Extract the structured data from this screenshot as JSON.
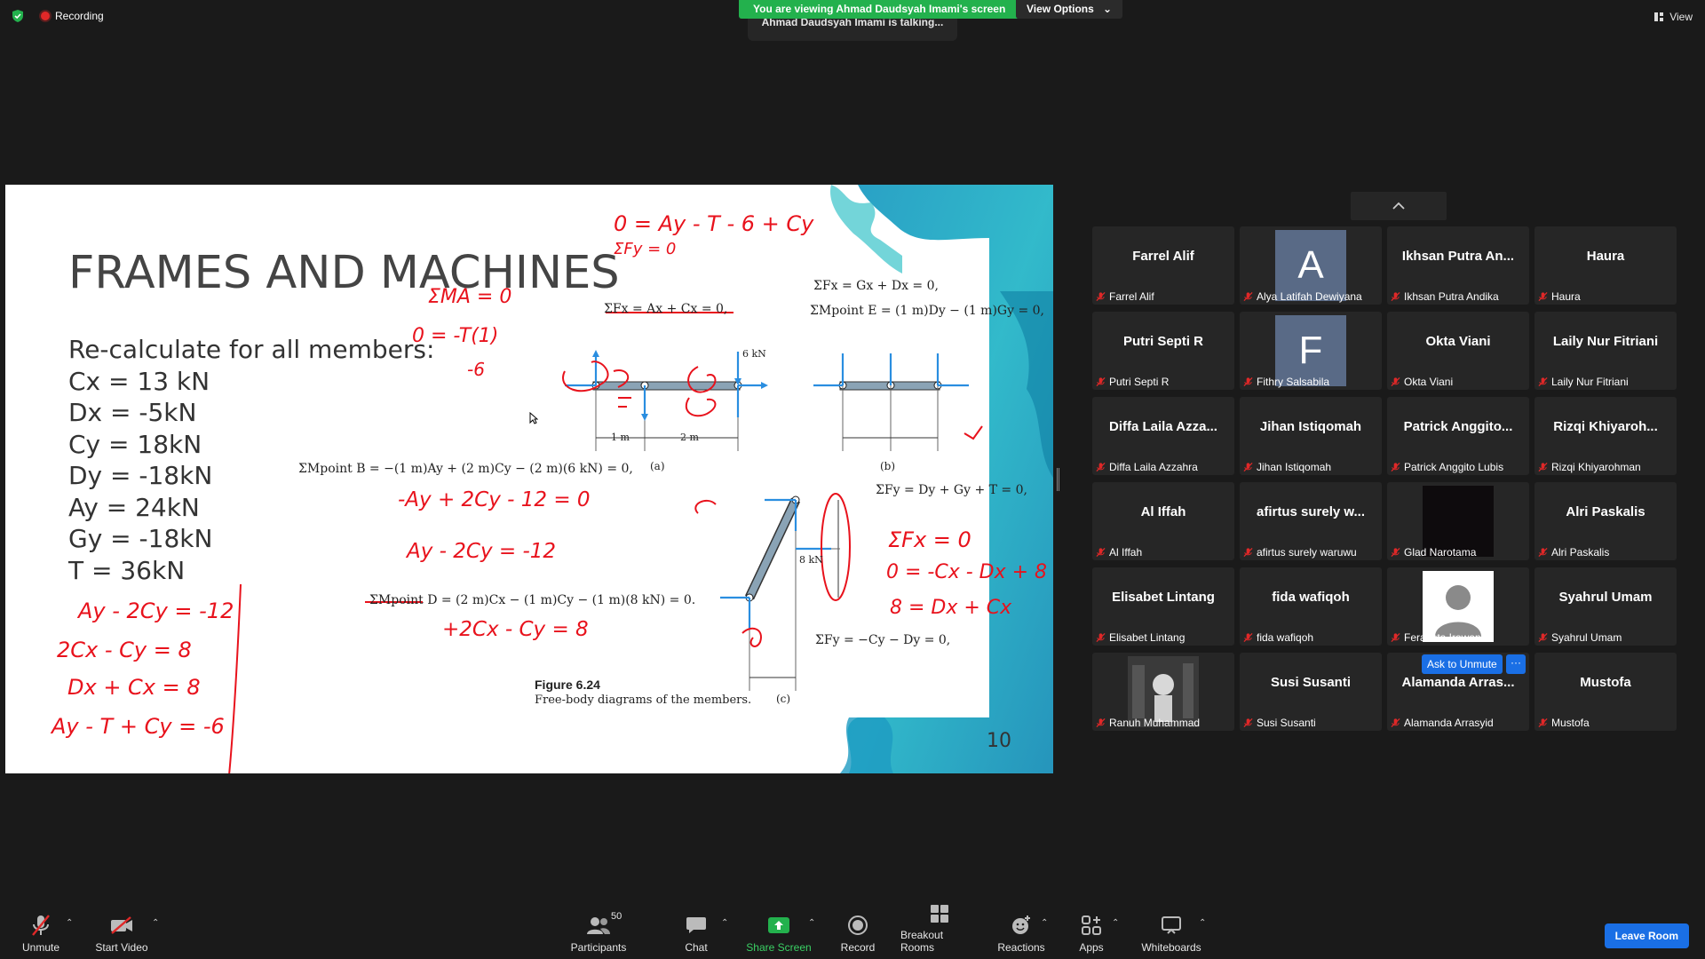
{
  "top_bar": {
    "recording_label": "Recording",
    "banner_text": "You are viewing Ahmad Daudsyah Imami's screen",
    "view_options_label": "View Options",
    "talking_text": "Ahmad Daudsyah Imami is talking...",
    "view_label": "View"
  },
  "slide": {
    "title": "FRAMES AND MACHINES",
    "lines": [
      "Re-calculate for all members:",
      "Cx = 13 kN",
      "Dx = -5kN",
      "Cy = 18kN",
      "Dy = -18kN",
      "Ay = 24kN",
      "Gy = -18kN",
      "T = 36kN"
    ],
    "page_number": "10",
    "figure_title": "Figure 6.24",
    "figure_caption": "Free-body diagrams of the members.",
    "eq_fx_a": "ΣFx = Ax + Cx = 0,",
    "eq_fx_g": "ΣFx = Gx + Dx = 0,",
    "eq_m_e": "ΣMpoint E = (1 m)Dy − (1 m)Gy = 0,",
    "eq_m_b": "ΣMpoint B = −(1 m)Ay + (2 m)Cy − (2 m)(6 kN) = 0,",
    "eq_fy_1": "ΣFy = Dy + Gy + T = 0,",
    "eq_m_d": "ΣMpoint D = (2 m)Cx − (1 m)Cy − (1 m)(8 kN) = 0.",
    "eq_fy_2": "ΣFy = −Cy − Dy = 0,",
    "diagram_labels": {
      "a": "(a)",
      "b": "(b)",
      "c": "(c)",
      "load_6": "6 kN",
      "load_8": "8 kN",
      "one_m": "1 m",
      "two_m": "2 m"
    },
    "handwriting": {
      "h1": "0 = Ay - T - 6 + Cy",
      "h2": "ΣFy = 0",
      "h3": "ΣMA = 0",
      "h4": "0 = -T(1)",
      "h5": "-6",
      "h6": "-Ay + 2Cy - 12 = 0",
      "h7": "Ay - 2Cy = -12",
      "h8": "+2Cx - Cy = 8",
      "h9": "ΣFx = 0",
      "h10": "0 = -Cx - Dx + 8",
      "h11": "8 = Dx + Cx",
      "h12": "Ay - 2Cy = -12",
      "h13": "2Cx - Cy = 8",
      "h14": "Dx + Cx = 8",
      "h15": "Ay - T + Cy = -6"
    }
  },
  "participants": [
    {
      "name": "Farrel Alif",
      "label": "Farrel Alif",
      "type": "text"
    },
    {
      "name": "",
      "label": "Alya Latifah Dewiyana",
      "type": "letter",
      "letter": "A"
    },
    {
      "name": "Ikhsan Putra An...",
      "label": "Ikhsan Putra Andika",
      "type": "text"
    },
    {
      "name": "Haura",
      "label": "Haura",
      "type": "text"
    },
    {
      "name": "Putri Septi R",
      "label": "Putri Septi R",
      "type": "text"
    },
    {
      "name": "",
      "label": "Fithry Salsabila",
      "type": "letter",
      "letter": "F"
    },
    {
      "name": "Okta Viani",
      "label": "Okta Viani",
      "type": "text"
    },
    {
      "name": "Laily Nur Fitriani",
      "label": "Laily Nur Fitriani",
      "type": "text"
    },
    {
      "name": "Diffa Laila Azza...",
      "label": "Diffa Laila Azzahra",
      "type": "text"
    },
    {
      "name": "Jihan Istiqomah",
      "label": "Jihan Istiqomah",
      "type": "text"
    },
    {
      "name": "Patrick Anggito...",
      "label": "Patrick Anggito Lubis",
      "type": "text"
    },
    {
      "name": "Rizqi Khiyaroh...",
      "label": "Rizqi Khiyarohman",
      "type": "text"
    },
    {
      "name": "Al Iffah",
      "label": "Al Iffah",
      "type": "text"
    },
    {
      "name": "afirtus surely w...",
      "label": "afirtus surely waruwu",
      "type": "text"
    },
    {
      "name": "",
      "label": "Glad Narotama",
      "type": "dark"
    },
    {
      "name": "Alri Paskalis",
      "label": "Alri Paskalis",
      "type": "text"
    },
    {
      "name": "Elisabet Lintang",
      "label": "Elisabet Lintang",
      "type": "text"
    },
    {
      "name": "fida wafiqoh",
      "label": "fida wafiqoh",
      "type": "text"
    },
    {
      "name": "",
      "label": "Ferarista Irawan",
      "type": "person"
    },
    {
      "name": "Syahrul Umam",
      "label": "Syahrul Umam",
      "type": "text"
    },
    {
      "name": "",
      "label": "Ranuh Muhammad",
      "type": "photo"
    },
    {
      "name": "Susi Susanti",
      "label": "Susi Susanti",
      "type": "text"
    },
    {
      "name": "Alamanda Arras...",
      "label": "Alamanda Arrasyid",
      "type": "text"
    },
    {
      "name": "Mustofa",
      "label": "Mustofa",
      "type": "text"
    }
  ],
  "ask_to_unmute": "Ask to Unmute",
  "ask_more": "···",
  "toolbar": {
    "unmute": "Unmute",
    "start_video": "Start Video",
    "participants": "Participants",
    "participants_count": "50",
    "chat": "Chat",
    "share_screen": "Share Screen",
    "record": "Record",
    "breakout_rooms": "Breakout Rooms",
    "reactions": "Reactions",
    "apps": "Apps",
    "whiteboards": "Whiteboards",
    "leave_room": "Leave Room"
  },
  "colors": {
    "banner": "#23b14d",
    "accent_blue": "#1a6fe5",
    "ink_red": "#e8121c",
    "tile_bg": "#262626",
    "app_bg": "#1a1a1a"
  }
}
